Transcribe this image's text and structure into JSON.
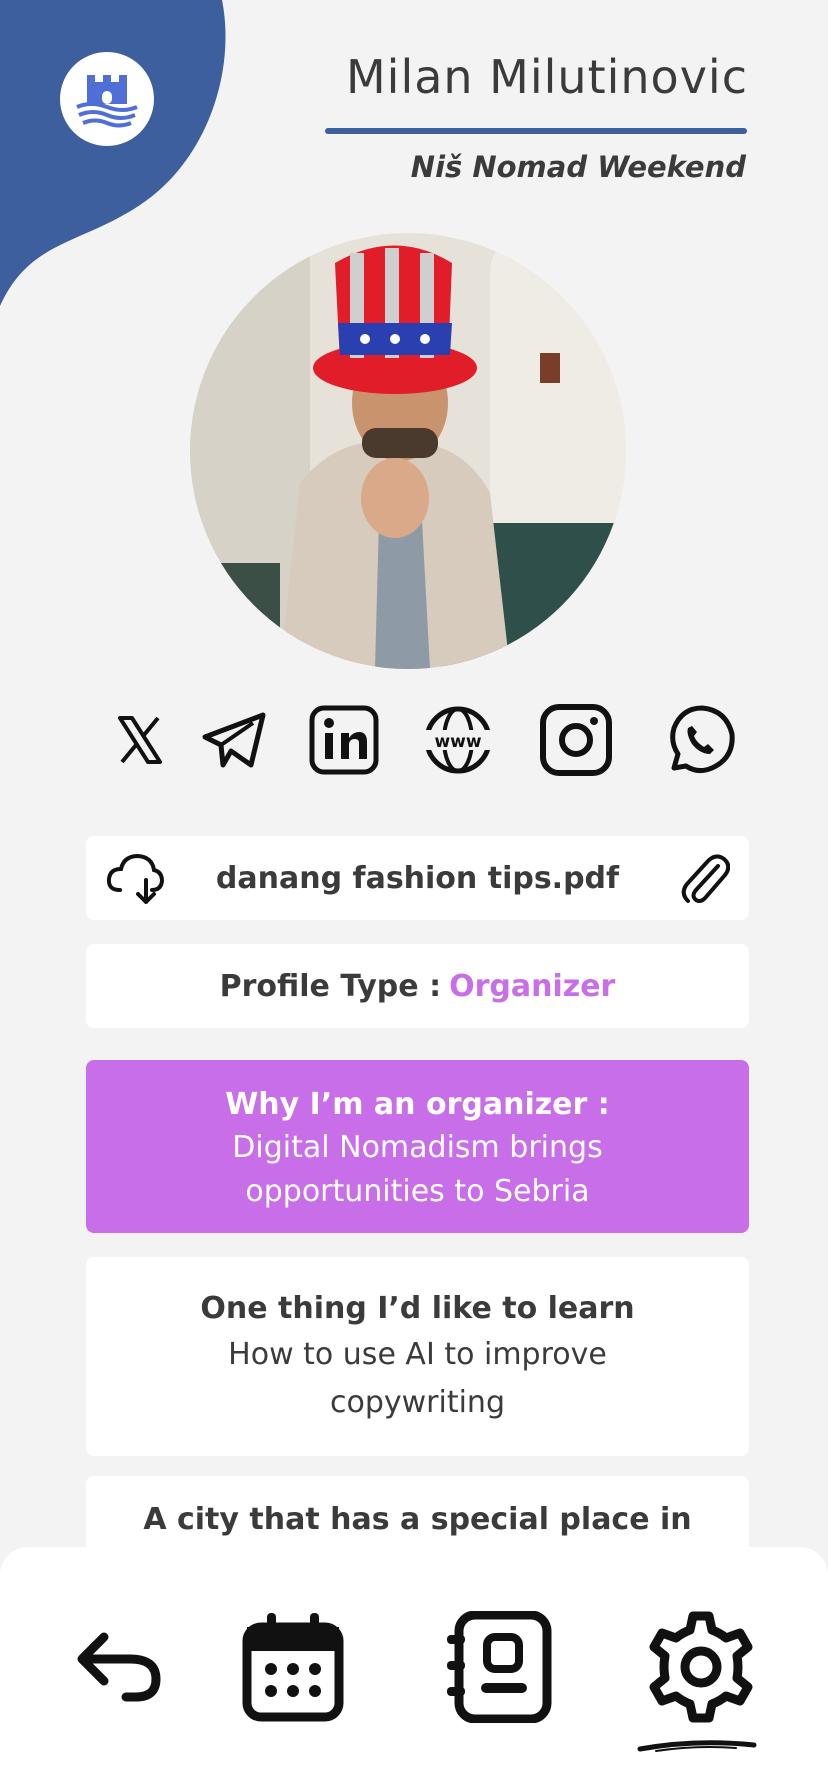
{
  "colors": {
    "brand_blue": "#3d5f9e",
    "accent_purple": "#c86ee8",
    "logo_blue": "#4f6fd6",
    "text_dark": "#3b3b3b",
    "background": "#f3f3f3"
  },
  "header": {
    "name": "Milan Milutinovic",
    "event": "Niš Nomad Weekend"
  },
  "profile": {
    "avatar": "profile-photo"
  },
  "socials": [
    {
      "icon": "x-icon"
    },
    {
      "icon": "telegram-icon"
    },
    {
      "icon": "linkedin-icon"
    },
    {
      "icon": "website-icon"
    },
    {
      "icon": "instagram-icon"
    },
    {
      "icon": "whatsapp-icon"
    }
  ],
  "attachment": {
    "file_name": "danang fashion tips.pdf",
    "download_icon": "cloud-download-icon",
    "attach_icon": "paperclip-icon"
  },
  "profile_type": {
    "label": "Profile Type :",
    "value": "Organizer"
  },
  "why": {
    "heading": "Why I’m an organizer :",
    "line1": "Digital Nomadism brings",
    "line2": "opportunities to Sebria"
  },
  "learn": {
    "heading": "One thing I’d like to learn",
    "line1": "How to use AI to improve",
    "line2": "copywriting"
  },
  "city": {
    "heading": "A city that has a special place in"
  },
  "bottom_nav": [
    {
      "icon": "back-arrow-icon"
    },
    {
      "icon": "calendar-icon"
    },
    {
      "icon": "contacts-icon"
    },
    {
      "icon": "settings-gear-icon",
      "active": true
    }
  ]
}
